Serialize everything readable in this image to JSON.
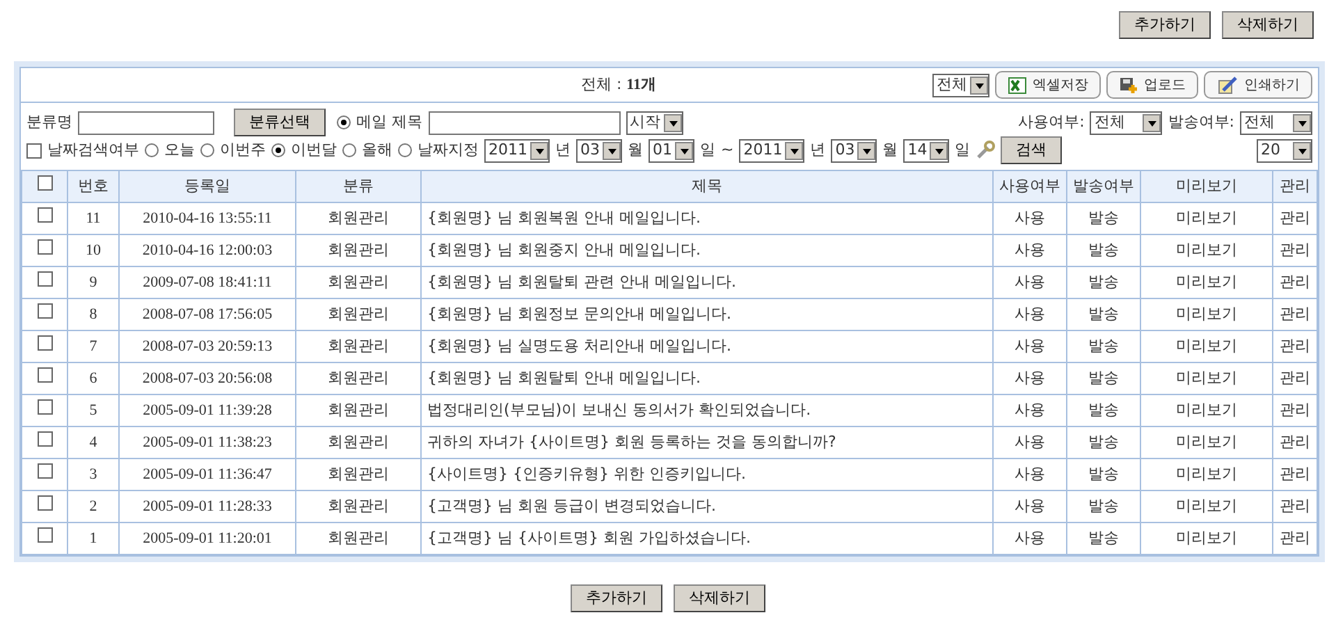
{
  "top_buttons": [
    "추가하기",
    "삭제하기"
  ],
  "summary": {
    "label": "전체 : ",
    "count": "11개"
  },
  "toolbar": {
    "filter_select": "전체",
    "buttons": [
      {
        "kind": "excel",
        "label": "엑셀저장"
      },
      {
        "kind": "upload",
        "label": "업로드"
      },
      {
        "kind": "print",
        "label": "인쇄하기"
      }
    ]
  },
  "search_row": {
    "category_label": "분류명",
    "category_button": "분류선택",
    "title_radio": {
      "label": "메일 제목",
      "selected": true
    },
    "match_select": "시작",
    "use_label": "사용여부:",
    "use_select": "전체",
    "send_label": "발송여부:",
    "send_select": "전체"
  },
  "date_row": {
    "date_search": {
      "label": "날짜검색여부",
      "checked": false
    },
    "periods": [
      {
        "label": "오늘",
        "selected": false
      },
      {
        "label": "이번주",
        "selected": false
      },
      {
        "label": "이번달",
        "selected": true
      },
      {
        "label": "올해",
        "selected": false
      },
      {
        "label": "날짜지정",
        "selected": false
      }
    ],
    "from": {
      "year": "2011",
      "year_unit": "년",
      "month": "03",
      "month_unit": "월",
      "day": "01",
      "day_unit": "일"
    },
    "separator": "~",
    "to": {
      "year": "2011",
      "year_unit": "년",
      "month": "03",
      "month_unit": "월",
      "day": "14",
      "day_unit": "일"
    },
    "search_button": "검색",
    "page_size": "20"
  },
  "table": {
    "columns": [
      "번호",
      "등록일",
      "분류",
      "제목",
      "사용여부",
      "발송여부",
      "미리보기",
      "관리"
    ],
    "select_all_checked": false,
    "rows": [
      {
        "checked": false,
        "cells": [
          "11",
          "2010-04-16 13:55:11",
          "회원관리",
          "{회원명} 님 회원복원 안내 메일입니다.",
          "사용",
          "발송",
          "미리보기",
          "관리"
        ]
      },
      {
        "checked": false,
        "cells": [
          "10",
          "2010-04-16 12:00:03",
          "회원관리",
          "{회원명} 님 회원중지 안내 메일입니다.",
          "사용",
          "발송",
          "미리보기",
          "관리"
        ]
      },
      {
        "checked": false,
        "cells": [
          "9",
          "2009-07-08 18:41:11",
          "회원관리",
          "{회원명} 님 회원탈퇴 관련 안내 메일입니다.",
          "사용",
          "발송",
          "미리보기",
          "관리"
        ]
      },
      {
        "checked": false,
        "cells": [
          "8",
          "2008-07-08 17:56:05",
          "회원관리",
          "{회원명} 님 회원정보 문의안내 메일입니다.",
          "사용",
          "발송",
          "미리보기",
          "관리"
        ]
      },
      {
        "checked": false,
        "cells": [
          "7",
          "2008-07-03 20:59:13",
          "회원관리",
          "{회원명} 님 실명도용 처리안내 메일입니다.",
          "사용",
          "발송",
          "미리보기",
          "관리"
        ]
      },
      {
        "checked": false,
        "cells": [
          "6",
          "2008-07-03 20:56:08",
          "회원관리",
          "{회원명} 님 회원탈퇴 안내 메일입니다.",
          "사용",
          "발송",
          "미리보기",
          "관리"
        ]
      },
      {
        "checked": false,
        "cells": [
          "5",
          "2005-09-01 11:39:28",
          "회원관리",
          "법정대리인(부모님)이 보내신 동의서가 확인되었습니다.",
          "사용",
          "발송",
          "미리보기",
          "관리"
        ]
      },
      {
        "checked": false,
        "cells": [
          "4",
          "2005-09-01 11:38:23",
          "회원관리",
          "귀하의 자녀가 {사이트명} 회원 등록하는 것을 동의합니까?",
          "사용",
          "발송",
          "미리보기",
          "관리"
        ]
      },
      {
        "checked": false,
        "cells": [
          "3",
          "2005-09-01 11:36:47",
          "회원관리",
          "{사이트명} {인증키유형} 위한 인증키입니다.",
          "사용",
          "발송",
          "미리보기",
          "관리"
        ]
      },
      {
        "checked": false,
        "cells": [
          "2",
          "2005-09-01 11:28:33",
          "회원관리",
          "{고객명} 님 회원 등급이 변경되었습니다.",
          "사용",
          "발송",
          "미리보기",
          "관리"
        ]
      },
      {
        "checked": false,
        "cells": [
          "1",
          "2005-09-01 11:20:01",
          "회원관리",
          "{고객명} 님 {사이트명} 회원 가입하셨습니다.",
          "사용",
          "발송",
          "미리보기",
          "관리"
        ]
      }
    ]
  },
  "bottom_buttons": [
    "추가하기",
    "삭제하기"
  ]
}
